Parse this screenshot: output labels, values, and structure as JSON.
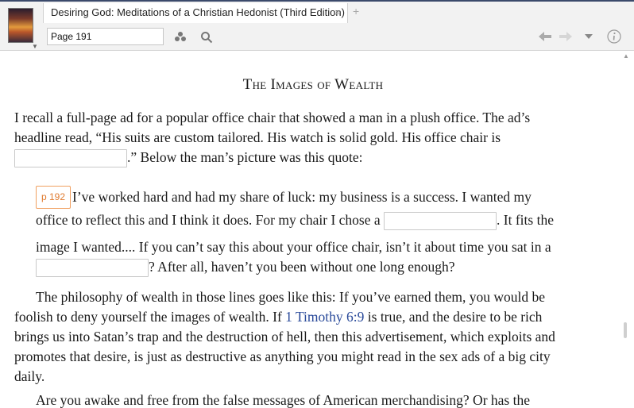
{
  "app": {
    "tab_title": "Desiring God: Meditations of a Christian Hedonist (Third Edition)",
    "tab_close": "×",
    "tab_add": "+"
  },
  "toolbar": {
    "page_value": "Page 191",
    "icons": [
      "book-cover",
      "dots-icon",
      "search-icon",
      "back-arrow-icon",
      "forward-arrow-icon",
      "chevron-down-icon",
      "info-icon"
    ]
  },
  "content": {
    "heading": "The Images of Wealth",
    "p1_l1": "I recall a full-page ad for a popular office chair that showed a man in a plush office. The ad’s",
    "p1_l2": "headline read, “His suits are custom tailored. His watch is solid gold. His office chair is",
    "p1_l3_after": ".” Below the man’s picture was this quote:",
    "page_marker": "p 192",
    "q_l1": "I’ve worked hard and had my share of luck: my business is a success. I wanted my",
    "q_l2_before": "office to reflect this and I think it does. For my chair I chose a",
    "q_l2_after": ". It fits the",
    "q_l3": "image I wanted.... If you can’t say this about your office chair, isn’t it about time you sat in a",
    "q_l4_after": "? After all, haven’t you been without one long enough?",
    "p2_l1": "The philosophy of wealth in those lines goes like this: If you’ve earned them, you would be",
    "p2_l2_before": "foolish to deny yourself the images of wealth. If ",
    "p2_ref": "1 Timothy 6:9",
    "p2_l2_after": " is true, and the desire to be rich",
    "p2_l3": "brings us into Satan’s trap and the destruction of hell, then this advertisement, which exploits and",
    "p2_l4": "promotes that desire, is just as destructive as anything you might read in the sex ads of a big city",
    "p2_l5": "daily.",
    "p3_l1": "Are you awake and free from the false messages of American merchandising? Or has the"
  },
  "colors": {
    "page_marker": "#e07b30",
    "link": "#2a4a9a",
    "top_accent": "#3b4a6b"
  }
}
